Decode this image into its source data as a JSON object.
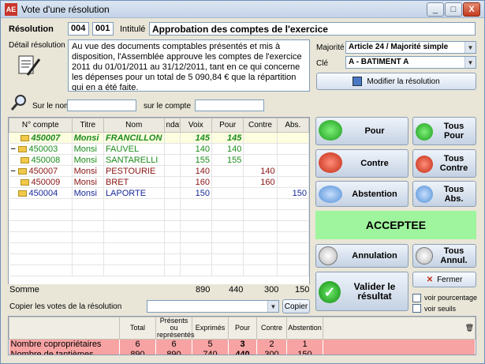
{
  "window": {
    "title": "Vote d'une résolution",
    "app_icon": "AE",
    "buttons": [
      "_",
      "□",
      "X"
    ]
  },
  "header": {
    "resolution_label": "Résolution",
    "resolution_num1": "004",
    "resolution_num2": "001",
    "intitule_label": "Intitulé",
    "intitule_value": "Approbation des comptes de l'exercice",
    "detail_label": "Détail résolution",
    "detail_text": "Au vue des documents comptables présentés et mis à disposition, l'Assemblée approuve les comptes de l'exercice 2011 du 01/01/2011 au 31/12/2011, tant en ce qui concerne les dépenses pour un total de   5 090,84 € que la répartition qui en a été faite.",
    "majorite_label": "Majorité",
    "majorite_value": "Article 24 / Majorité simple",
    "cle_label": "Clé",
    "cle_value": "A - BATIMENT A",
    "modify_button": "Modifier la résolution"
  },
  "search": {
    "nom_label": "Sur le nom",
    "compte_label": "sur le compte"
  },
  "grid": {
    "columns": [
      "N° compte",
      "Titre",
      "Nom",
      "ndati",
      "Voix",
      "Pour",
      "Contre",
      "Abs."
    ],
    "rows": [
      {
        "compte": "450007",
        "titre": "Monsi",
        "nom": "FRANCILLON",
        "voix": "145",
        "pour": "145",
        "contre": "",
        "abs": "",
        "color": "#1c8c1c",
        "indent": 1,
        "bold": true,
        "italic": true,
        "folder": true,
        "selected": true
      },
      {
        "compte": "450003",
        "titre": "Monsi",
        "nom": "FAUVEL",
        "voix": "140",
        "pour": "140",
        "contre": "",
        "abs": "",
        "color": "#1c8c1c",
        "indent": 0,
        "folder": true,
        "expander": "−"
      },
      {
        "compte": "450008",
        "titre": "Monsi",
        "nom": "SANTARELLI",
        "voix": "155",
        "pour": "155",
        "contre": "",
        "abs": "",
        "color": "#1c8c1c",
        "indent": 1,
        "folder": true
      },
      {
        "compte": "450007",
        "titre": "Monsi",
        "nom": "PESTOURIE",
        "voix": "140",
        "pour": "",
        "contre": "140",
        "abs": "",
        "color": "#8b1414",
        "indent": 0,
        "folder": true,
        "expander": "−"
      },
      {
        "compte": "450009",
        "titre": "Monsi",
        "nom": "BRET",
        "voix": "160",
        "pour": "",
        "contre": "160",
        "abs": "",
        "color": "#8b1414",
        "indent": 1,
        "folder": true
      },
      {
        "compte": "450004",
        "titre": "Monsi",
        "nom": "LAPORTE",
        "voix": "150",
        "pour": "",
        "contre": "",
        "abs": "150",
        "color": "#1a2a9a",
        "indent": 0,
        "folder": true
      }
    ],
    "somme_label": "Somme",
    "somme_voix": "890",
    "somme_pour": "440",
    "somme_contre": "300",
    "somme_abs": "150"
  },
  "copy": {
    "label": "Copier les votes de la résolution",
    "button": "Copier"
  },
  "actions": {
    "pour": "Pour",
    "tous_pour": "Tous Pour",
    "contre": "Contre",
    "tous_contre": "Tous Contre",
    "abstention": "Abstention",
    "tous_abs": "Tous Abs.",
    "status": "ACCEPTEE",
    "annulation": "Annulation",
    "tous_annul": "Tous Annul.",
    "valider": "Valider le résultat",
    "fermer": "Fermer",
    "voir_pourcentage": "voir pourcentage",
    "voir_seuils": "voir seuils"
  },
  "summary": {
    "columns": [
      "",
      "Total",
      "Présents ou représentés",
      "Exprimés",
      "Pour",
      "Contre",
      "Abstention",
      ""
    ],
    "rows": [
      {
        "label": "Nombre copropriétaires",
        "total": "6",
        "presents": "6",
        "exprimes": "5",
        "pour": "3",
        "contre": "2",
        "abs": "1"
      },
      {
        "label": "Nombre de tantièmes",
        "total": "890",
        "presents": "890",
        "exprimes": "740",
        "pour": "440",
        "contre": "300",
        "abs": "150"
      }
    ]
  },
  "colors": {
    "accept_bg": "#9ff59d",
    "summary_bg": "#f7a3a3",
    "pour_green": "#1c8c1c",
    "contre_red": "#8b1414"
  }
}
